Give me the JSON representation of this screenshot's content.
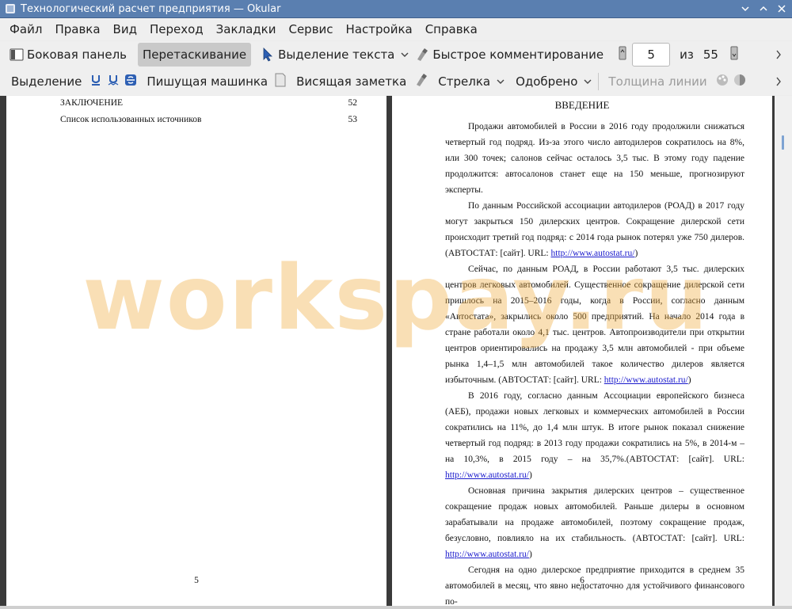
{
  "window": {
    "title": "Технологический расчет предприятия  — Okular"
  },
  "menu": [
    "Файл",
    "Правка",
    "Вид",
    "Переход",
    "Закладки",
    "Сервис",
    "Настройка",
    "Справка"
  ],
  "toolbar1": {
    "sidebar": "Боковая панель",
    "drag": "Перетаскивание",
    "text_select": "Выделение текста",
    "quick_comment": "Быстрое комментирование",
    "current_page": "5",
    "of": "из",
    "total_pages": "55"
  },
  "toolbar2": {
    "selection": "Выделение",
    "typewriter": "Пишущая машинка",
    "sticky_note": "Висящая заметка",
    "arrow": "Стрелка",
    "approved": "Одобрено",
    "line_width": "Толщина линии"
  },
  "page5": {
    "toc": [
      {
        "title": "ЗАКЛЮЧЕНИЕ",
        "page": "52"
      },
      {
        "title": "Список использованных источников",
        "page": "53"
      }
    ],
    "page_number": "5"
  },
  "page6": {
    "heading": "ВВЕДЕНИЕ",
    "p1": "Продажи автомобилей в России в 2016 году продолжили снижаться четвертый год подряд. Из-за этого число автодилеров сократилось на 8%, или 300 точек; салонов сейчас осталось 3,5 тыс. В этому году падение продолжится: автосалонов станет еще на 150 меньше, прогнозируют эксперты.",
    "p2": "По данным Российской ассоциации автодилеров (РОАД) в 2017 году могут закрыться 150 дилерских центров. Сокращение дилерской сети происходит третий год подряд: с 2014 года рынок потерял уже 750 дилеров. (АВТОСТАТ: [сайт]. URL: ",
    "p2_link": "http://www.autostat.ru/",
    "p2_end": ")",
    "p3": "Сейчас, по данным РОАД, в России работают 3,5 тыс. дилерских центров легковых автомобилей. Существенное сокращение дилерской сети пришлось на 2015–2016 годы, когда в России, согласно данным «Автостата», закрылись около 500 предприятий. На начало 2014 года в стране работали около 4,1 тыс. центров. Автопроизводители при открытии центров ориентировались на продажу 3,5 млн автомобилей - при объеме рынка 1,4–1,5 млн автомобилей такое количество дилеров является избыточным. (АВТОСТАТ: [сайт]. URL: ",
    "p3_link": "http://www.autostat.ru/",
    "p3_end": ")",
    "p4": "В 2016 году, согласно данным Ассоциации европейского бизнеса (АЕБ), продажи новых легковых и коммерческих автомобилей в России сократились на 11%, до 1,4 млн штук. В итоге рынок показал снижение четвертый год подряд: в 2013 году продажи сократились на 5%, в 2014-м – на 10,3%, в 2015 году – на 35,7%.(АВТОСТАТ: [сайт]. URL: ",
    "p4_link": "http://www.autostat.ru/",
    "p4_end": ")",
    "p5": "Основная причина закрытия дилерских центров – существенное сокращение продаж новых автомобилей. Раньше дилеры в основном зарабатывали на продаже автомобилей, поэтому сокращение продаж, безусловно, повлияло на их стабильность. (АВТОСТАТ: [сайт]. URL: ",
    "p5_link": "http://www.autostat.ru/",
    "p5_end": ")",
    "p6": "Сегодня на одно дилерское предприятие приходится в среднем 35 автомобилей в месяц, что явно недостаточно для устойчивого финансового по-",
    "page_number": "6"
  },
  "watermark": "workspay.ru"
}
